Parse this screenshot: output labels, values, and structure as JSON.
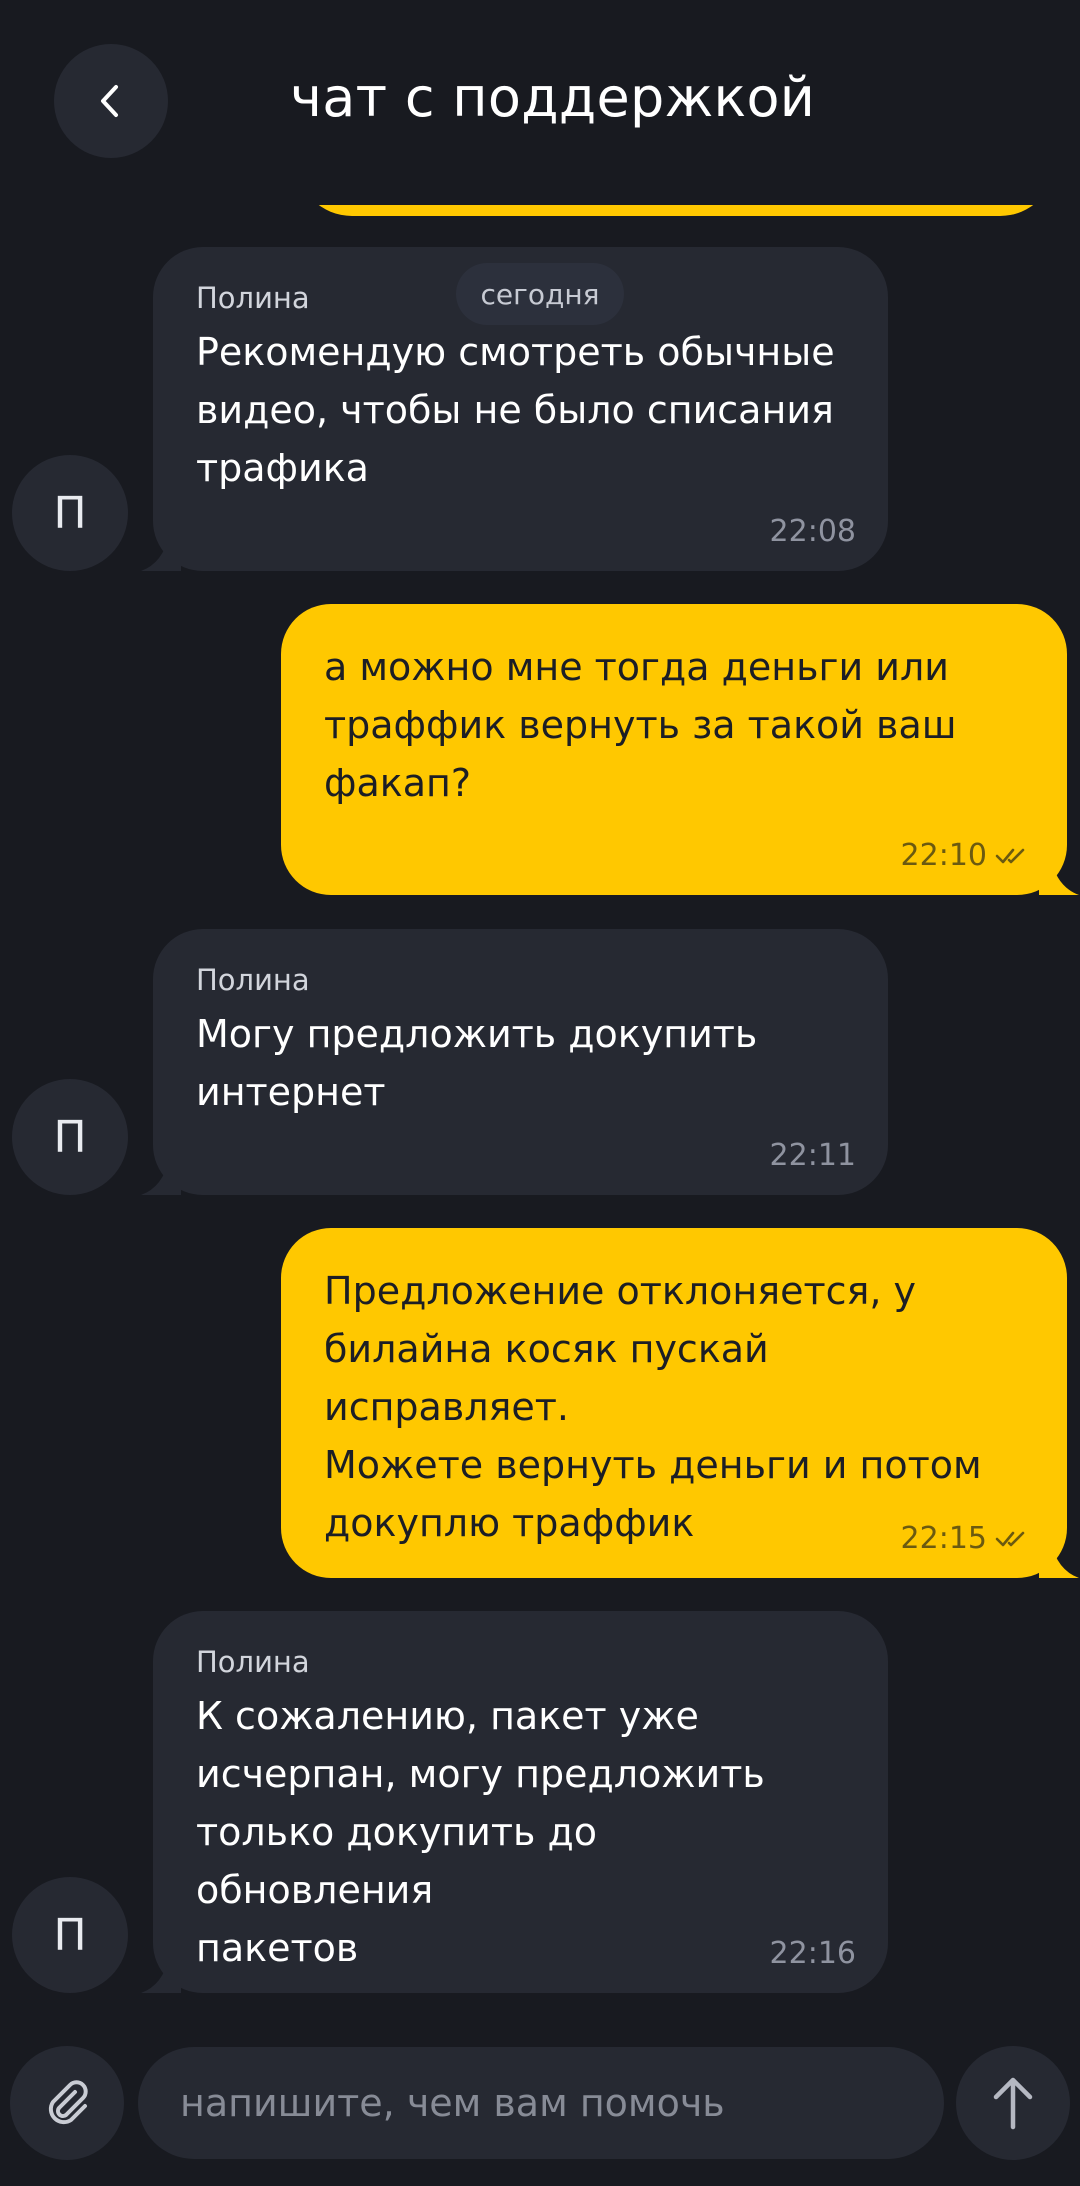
{
  "header": {
    "title": "чат с поддержкой"
  },
  "date_chip": "сегодня",
  "messages": [
    {
      "direction": "incoming",
      "avatar": "П",
      "sender": "Полина",
      "lines": [
        "Рекомендую смотреть обычные",
        "видео, чтобы не было списания",
        "трафика"
      ],
      "time": "22:08"
    },
    {
      "direction": "outgoing",
      "lines": [
        "а можно мне тогда деньги или",
        "траффик вернуть за такой ваш",
        "факап?"
      ],
      "time": "22:10",
      "status_icon": "double-check-icon"
    },
    {
      "direction": "incoming",
      "avatar": "П",
      "sender": "Полина",
      "lines": [
        "Могу предложить докупить",
        "интернет"
      ],
      "time": "22:11"
    },
    {
      "direction": "outgoing",
      "lines": [
        "Предложение отклоняется, у",
        "билайна косяк пускай исправляет.",
        "Можете вернуть деньги и потом",
        "докуплю траффик"
      ],
      "time": "22:15",
      "status_icon": "double-check-icon"
    },
    {
      "direction": "incoming",
      "avatar": "П",
      "sender": "Полина",
      "lines": [
        "К сожалению, пакет уже",
        "исчерпан, могу предложить",
        "только докупить до обновления",
        "пакетов"
      ],
      "time": "22:16"
    }
  ],
  "composer": {
    "placeholder": "напишите, чем вам помочь",
    "value": ""
  },
  "icons": {
    "back": "chevron-left-icon",
    "attach": "paperclip-icon",
    "send": "arrow-up-icon"
  },
  "colors": {
    "background": "#181a20",
    "incoming_bubble": "#262932",
    "outgoing_bubble": "#ffc800"
  }
}
